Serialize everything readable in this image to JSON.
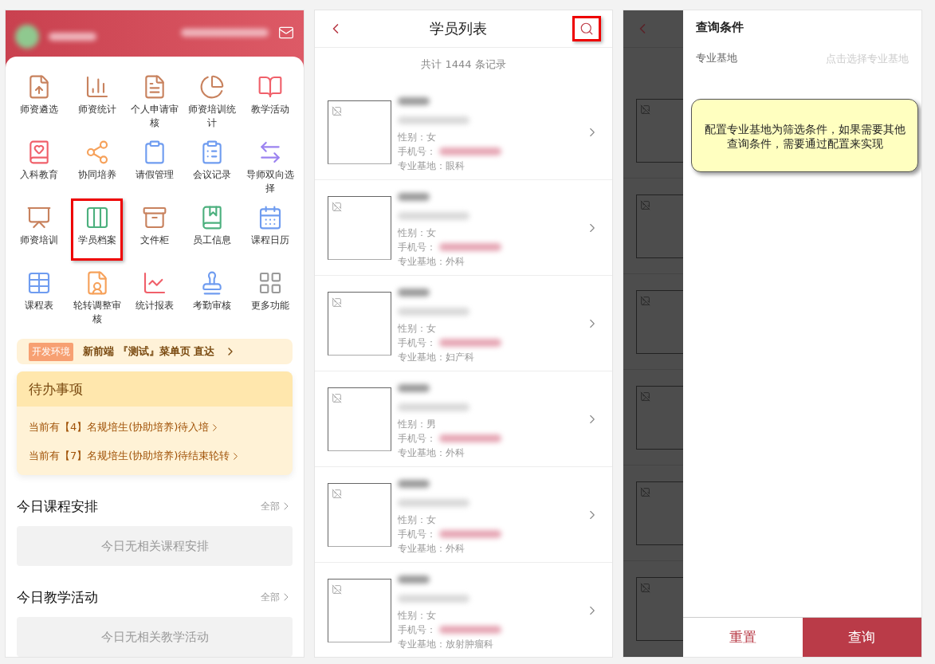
{
  "home": {
    "menu": [
      {
        "label": "师资遴选",
        "color": "#c8825e",
        "highlighted": false
      },
      {
        "label": "师资统计",
        "color": "#c8825e",
        "highlighted": false
      },
      {
        "label": "个人申请审核",
        "color": "#c8825e",
        "highlighted": false
      },
      {
        "label": "师资培训统计",
        "color": "#c8825e",
        "highlighted": false
      },
      {
        "label": "教学活动",
        "color": "#f0606a",
        "highlighted": false
      },
      {
        "label": "入科教育",
        "color": "#f0606a",
        "highlighted": false
      },
      {
        "label": "协同培养",
        "color": "#f6a15a",
        "highlighted": false
      },
      {
        "label": "请假管理",
        "color": "#6f9cf0",
        "highlighted": false
      },
      {
        "label": "会议记录",
        "color": "#6f9cf0",
        "highlighted": false
      },
      {
        "label": "导师双向选择",
        "color": "#9b82f0",
        "highlighted": false
      },
      {
        "label": "师资培训",
        "color": "#c8825e",
        "highlighted": false
      },
      {
        "label": "学员档案",
        "color": "#4cb07e",
        "highlighted": true
      },
      {
        "label": "文件柜",
        "color": "#c8825e",
        "highlighted": false
      },
      {
        "label": "员工信息",
        "color": "#4cb07e",
        "highlighted": false
      },
      {
        "label": "课程日历",
        "color": "#6f9cf0",
        "highlighted": false
      },
      {
        "label": "课程表",
        "color": "#6f9cf0",
        "highlighted": false
      },
      {
        "label": "轮转调整审核",
        "color": "#f6a15a",
        "highlighted": false
      },
      {
        "label": "统计报表",
        "color": "#f0606a",
        "highlighted": false
      },
      {
        "label": "考勤审核",
        "color": "#6f9cf0",
        "highlighted": false
      },
      {
        "label": "更多功能",
        "color": "#999999",
        "highlighted": false
      }
    ],
    "dev_banner": {
      "tag": "开发环境",
      "text": "新前端 『测试』菜单页 直达"
    },
    "todo": {
      "title": "待办事项",
      "items": [
        "当前有【4】名规培生(协助培养)待入培",
        "当前有【7】名规培生(协助培养)待结束轮转"
      ]
    },
    "sections": [
      {
        "title": "今日课程安排",
        "more": "全部",
        "empty": "今日无相关课程安排"
      },
      {
        "title": "今日教学活动",
        "more": "全部",
        "empty": "今日无相关教学活动"
      }
    ]
  },
  "student_list": {
    "title": "学员列表",
    "search_highlighted": true,
    "count": "共计 1444 条记录",
    "rows": [
      {
        "gender": "性别：女",
        "phone_label": "手机号：",
        "base": "专业基地：眼科"
      },
      {
        "gender": "性别：女",
        "phone_label": "手机号：",
        "base": "专业基地：外科"
      },
      {
        "gender": "性别：女",
        "phone_label": "手机号：",
        "base": "专业基地：妇产科"
      },
      {
        "gender": "性别：男",
        "phone_label": "手机号：",
        "base": "专业基地：外科"
      },
      {
        "gender": "性别：女",
        "phone_label": "手机号：",
        "base": "专业基地：外科"
      },
      {
        "gender": "性别：女",
        "phone_label": "手机号：",
        "base": "专业基地：放射肿瘤科"
      }
    ]
  },
  "filter": {
    "title": "查询条件",
    "field": {
      "label": "专业基地",
      "placeholder": "点击选择专业基地"
    },
    "note": "配置专业基地为筛选条件，如果需要其他查询条件，需要通过配置来实现",
    "buttons": [
      {
        "label": "重置",
        "kind": "secondary"
      },
      {
        "label": "查询",
        "kind": "primary"
      }
    ]
  }
}
